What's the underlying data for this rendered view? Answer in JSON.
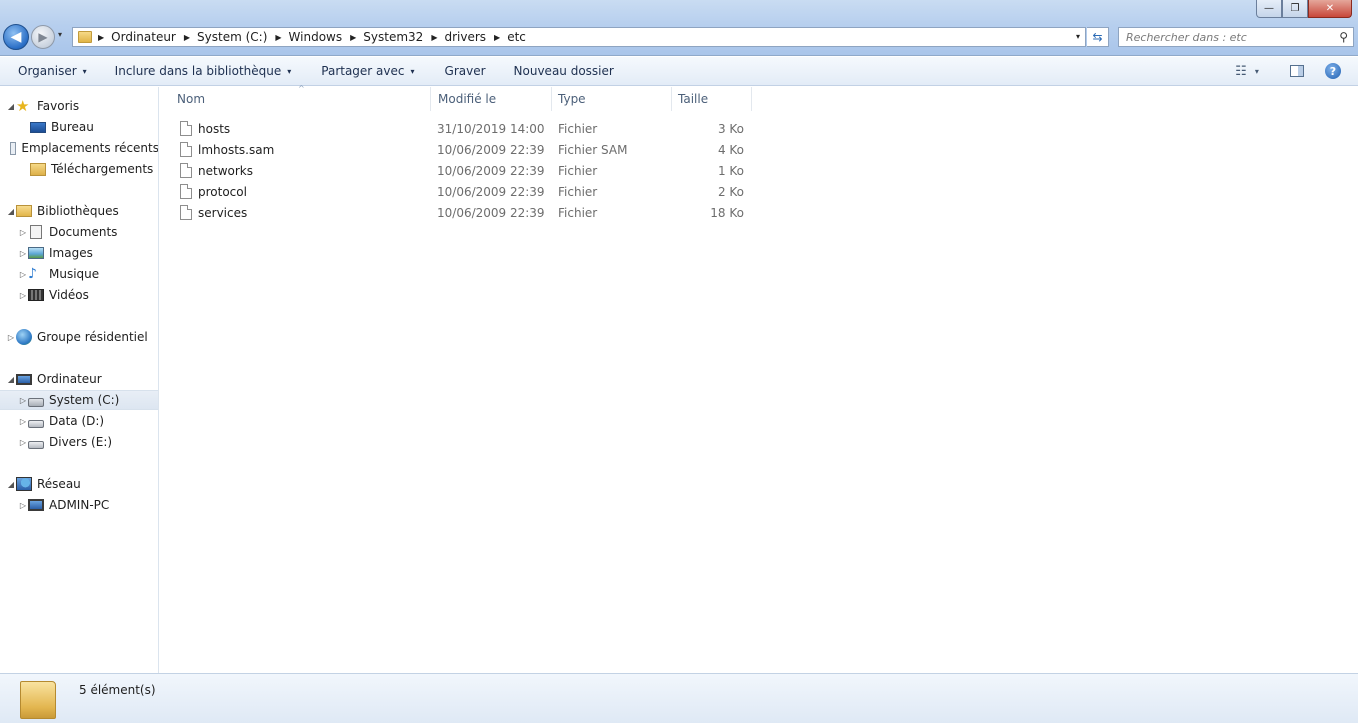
{
  "window": {
    "controls": {
      "minimize": "—",
      "maximize": "❐",
      "close": "✕"
    }
  },
  "navigation": {
    "back_glyph": "◀",
    "forward_glyph": "▶",
    "dropdown_glyph": "▾"
  },
  "address_bar": {
    "crumbs": [
      "Ordinateur",
      "System (C:)",
      "Windows",
      "System32",
      "drivers",
      "etc"
    ],
    "separator": "▶",
    "dropdown_glyph": "▾",
    "refresh_glyph": "⇆"
  },
  "search": {
    "placeholder": "Rechercher dans : etc",
    "icon_glyph": "⚲"
  },
  "toolbar": {
    "organize": "Organiser",
    "include_library": "Inclure dans la bibliothèque",
    "share_with": "Partager avec",
    "burn": "Graver",
    "new_folder": "Nouveau dossier",
    "caret": "▾",
    "view_glyph": "☷",
    "help_glyph": "?"
  },
  "sidebar": {
    "sections": [
      {
        "label": "Favoris",
        "items": [
          "Bureau",
          "Emplacements récents",
          "Téléchargements"
        ]
      },
      {
        "label": "Bibliothèques",
        "items": [
          "Documents",
          "Images",
          "Musique",
          "Vidéos"
        ]
      },
      {
        "label": "Groupe résidentiel",
        "items": []
      },
      {
        "label": "Ordinateur",
        "items": [
          "System (C:)",
          "Data (D:)",
          "Divers (E:)"
        ]
      },
      {
        "label": "Réseau",
        "items": [
          "ADMIN-PC"
        ]
      }
    ],
    "expanded_glyph": "◢",
    "collapsed_glyph": "▷",
    "selected": "System (C:)"
  },
  "columns": {
    "name": "Nom",
    "modified": "Modifié le",
    "type": "Type",
    "size": "Taille",
    "sort_glyph": "^"
  },
  "files": [
    {
      "name": "hosts",
      "modified": "31/10/2019 14:00",
      "type": "Fichier",
      "size": "3 Ko"
    },
    {
      "name": "lmhosts.sam",
      "modified": "10/06/2009 22:39",
      "type": "Fichier SAM",
      "size": "4 Ko"
    },
    {
      "name": "networks",
      "modified": "10/06/2009 22:39",
      "type": "Fichier",
      "size": "1 Ko"
    },
    {
      "name": "protocol",
      "modified": "10/06/2009 22:39",
      "type": "Fichier",
      "size": "2 Ko"
    },
    {
      "name": "services",
      "modified": "10/06/2009 22:39",
      "type": "Fichier",
      "size": "18 Ko"
    }
  ],
  "status": {
    "item_count": "5 élément(s)"
  },
  "colors": {
    "accent": "#2a6ec6",
    "selection": "#dde6f1",
    "toolbar_bg": "#e3ecf7"
  }
}
